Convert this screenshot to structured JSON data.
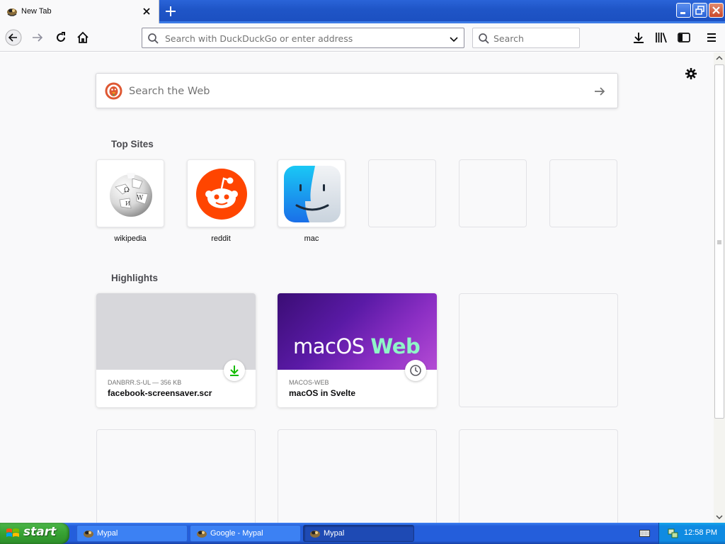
{
  "window": {
    "tab_title": "New Tab"
  },
  "toolbar": {
    "address_placeholder": "Search with DuckDuckGo or enter address",
    "search_placeholder": "Search"
  },
  "newtab": {
    "web_search_placeholder": "Search the Web",
    "top_sites_heading": "Top Sites",
    "top_sites": [
      {
        "label": "wikipedia",
        "icon": "wikipedia-globe-icon"
      },
      {
        "label": "reddit",
        "icon": "reddit-alien-icon"
      },
      {
        "label": "mac",
        "icon": "macos-finder-icon"
      },
      {
        "label": ""
      },
      {
        "label": ""
      },
      {
        "label": ""
      }
    ],
    "highlights_heading": "Highlights",
    "highlights": [
      {
        "meta": "DANBRR.S-UL — 356 KB",
        "title": "facebook-screensaver.scr",
        "badge": "download-icon"
      },
      {
        "meta": "MACOS-WEB",
        "title": "macOS in Svelte",
        "badge": "clock-icon",
        "thumb_text_a": "macOS",
        "thumb_text_b": "Web"
      }
    ]
  },
  "taskbar": {
    "start_label": "start",
    "tasks": [
      "Mypal",
      "Google - Mypal",
      "Mypal"
    ],
    "clock": "12:58 PM"
  },
  "colors": {
    "accent": "#0a84ff",
    "download_green": "#12bc00",
    "reddit_orange": "#ff4500",
    "xp_taskbar": "#245edb",
    "xp_start_green": "#37a233"
  }
}
